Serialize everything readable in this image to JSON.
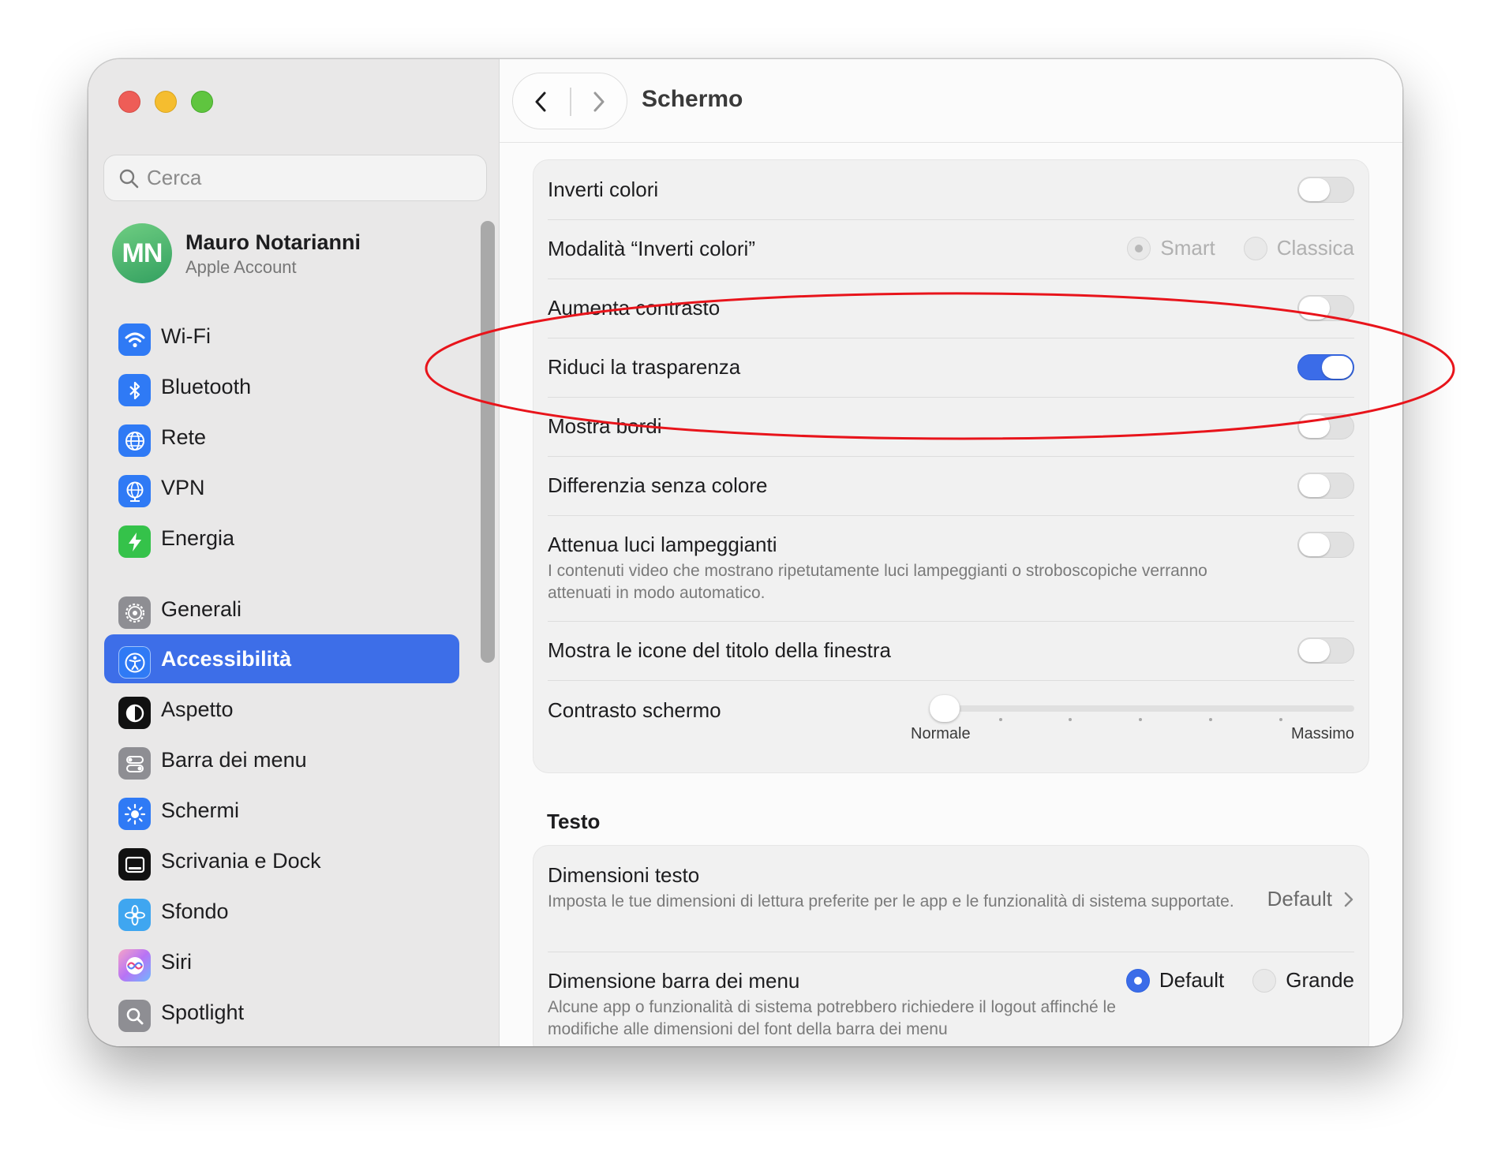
{
  "search": {
    "placeholder": "Cerca"
  },
  "account": {
    "initials": "MN",
    "name": "Mauro Notarianni",
    "subtitle": "Apple Account"
  },
  "sidebar": {
    "items": [
      {
        "label": "Wi-Fi",
        "icon": "wifi-icon",
        "color": "#2f7af5"
      },
      {
        "label": "Bluetooth",
        "icon": "bluetooth-icon",
        "color": "#2f7af5"
      },
      {
        "label": "Rete",
        "icon": "globe-icon",
        "color": "#2f7af5"
      },
      {
        "label": "VPN",
        "icon": "vpn-globe-icon",
        "color": "#2f7af5"
      },
      {
        "label": "Energia",
        "icon": "bolt-icon",
        "color": "#35c24a"
      },
      {
        "label": "Generali",
        "icon": "gear-icon",
        "color": "#8e8e93"
      },
      {
        "label": "Accessibilità",
        "icon": "accessibility-icon",
        "color": "#2f7af5",
        "active": true
      },
      {
        "label": "Aspetto",
        "icon": "appearance-icon",
        "color": "#111111"
      },
      {
        "label": "Barra dei menu",
        "icon": "menubar-toggle-icon",
        "color": "#8e8e93"
      },
      {
        "label": "Schermi",
        "icon": "sun-icon",
        "color": "#2f7af5"
      },
      {
        "label": "Scrivania e Dock",
        "icon": "dock-icon",
        "color": "#111111"
      },
      {
        "label": "Sfondo",
        "icon": "flower-icon",
        "color": "#3fa6f0"
      },
      {
        "label": "Siri",
        "icon": "siri-icon",
        "color": "#e84a8c"
      },
      {
        "label": "Spotlight",
        "icon": "magnifier-icon",
        "color": "#8e8e93"
      }
    ]
  },
  "header": {
    "title": "Schermo"
  },
  "display": {
    "invert": {
      "label": "Inverti colori",
      "on": false
    },
    "invert_mode": {
      "label": "Modalità “Inverti colori”",
      "option1": "Smart",
      "option2": "Classica"
    },
    "contrast": {
      "label": "Aumenta contrasto",
      "on": false
    },
    "transparency": {
      "label": "Riduci la trasparenza",
      "on": true
    },
    "borders": {
      "label": "Mostra bordi",
      "on": false
    },
    "differentiate": {
      "label": "Differenzia senza colore",
      "on": false
    },
    "flashing": {
      "label": "Attenua luci lampeggianti",
      "desc": "I contenuti video che mostrano ripetutamente luci lampeggianti o stroboscopiche verranno attenuati in modo automatico.",
      "on": false
    },
    "title_icons": {
      "label": "Mostra le icone del titolo della finestra",
      "on": false
    },
    "screen_contrast": {
      "label": "Contrasto schermo",
      "min": "Normale",
      "max": "Massimo",
      "level": 0
    }
  },
  "text_section": {
    "title": "Testo",
    "text_size": {
      "label": "Dimensioni testo",
      "desc": "Imposta le tue dimensioni di lettura preferite per le app e le funzionalità di sistema supportate.",
      "value": "Default"
    },
    "menubar_size": {
      "label": "Dimensione barra dei menu",
      "desc": "Alcune app o funzionalità di sistema potrebbero richiedere il logout affinché le modifiche alle dimensioni del font della barra dei menu",
      "option1": "Default",
      "option2": "Grande",
      "selected": "Default"
    }
  },
  "colors": {
    "accent": "#3b6ce8",
    "annotation": "#e8141b"
  }
}
